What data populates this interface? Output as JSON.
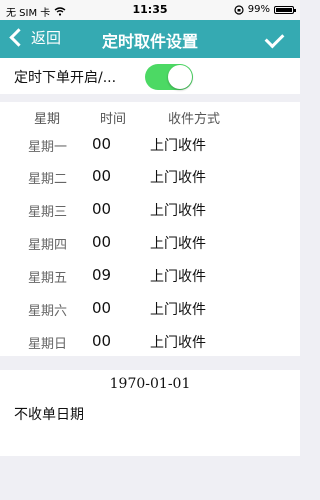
{
  "status_bar": {
    "carrier": "无 SIM 卡",
    "wifi_icon": "wifi-icon",
    "time": "11:35",
    "lock_icon": "rotation-lock-icon",
    "battery_pct": "99%",
    "battery_level": 0.99
  },
  "nav": {
    "back_label": "返回",
    "title": "定时取件设置",
    "confirm_icon": "checkmark-icon",
    "color": "#35aab2"
  },
  "toggle": {
    "label": "定时下单开启/...",
    "on": true,
    "color": "#4cd964"
  },
  "schedule": {
    "headers": [
      "星期",
      "时间",
      "收件方式"
    ],
    "rows": [
      {
        "day": "星期一",
        "time": "00",
        "method": "上门收件"
      },
      {
        "day": "星期二",
        "time": "00",
        "method": "上门收件"
      },
      {
        "day": "星期三",
        "time": "00",
        "method": "上门收件"
      },
      {
        "day": "星期四",
        "time": "00",
        "method": "上门收件"
      },
      {
        "day": "星期五",
        "time": "09",
        "method": "上门收件"
      },
      {
        "day": "星期六",
        "time": "00",
        "method": "上门收件"
      },
      {
        "day": "星期日",
        "time": "00",
        "method": "上门收件"
      }
    ]
  },
  "no_pickup": {
    "date": "1970-01-01",
    "label": "不收单日期"
  }
}
